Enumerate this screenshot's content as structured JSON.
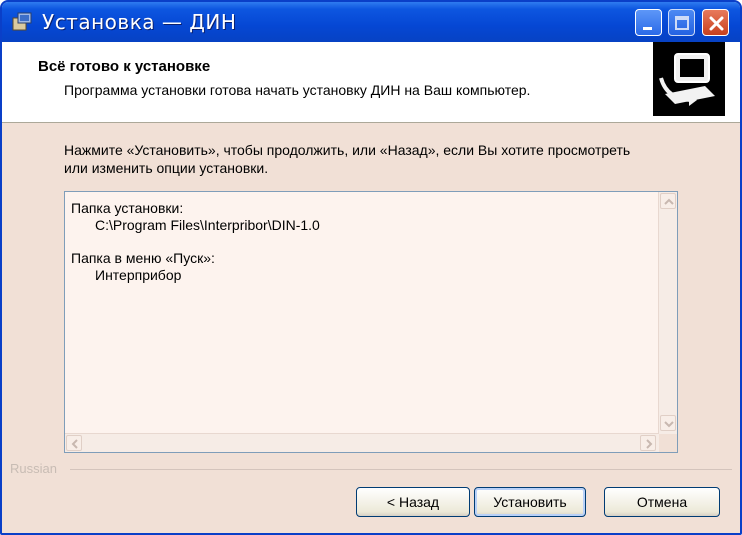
{
  "window": {
    "title": "Установка — ДИН",
    "buttons": [
      "minimize",
      "maximize",
      "close"
    ]
  },
  "header": {
    "title": "Всё готово к установке",
    "subtitle": "Программа установки готова начать установку ДИН на Ваш компьютер.",
    "icon": "computer-install-icon"
  },
  "body": {
    "instruction": "Нажмите «Установить», чтобы продолжить, или «Назад», если Вы хотите просмотреть или изменить опции установки.",
    "memo": {
      "install_folder_label": "Папка установки:",
      "install_folder_value": "C:\\Program Files\\Interpribor\\DIN-1.0",
      "start_menu_label": "Папка в меню «Пуск»:",
      "start_menu_value": "Интерприбор"
    }
  },
  "footer": {
    "language": "Russian",
    "back_label": "< Назад",
    "install_label": "Установить",
    "cancel_label": "Отмена"
  },
  "colors": {
    "titlebar": "#0547d4",
    "body_bg": "#f1e0d6",
    "button_border": "#003c74"
  }
}
